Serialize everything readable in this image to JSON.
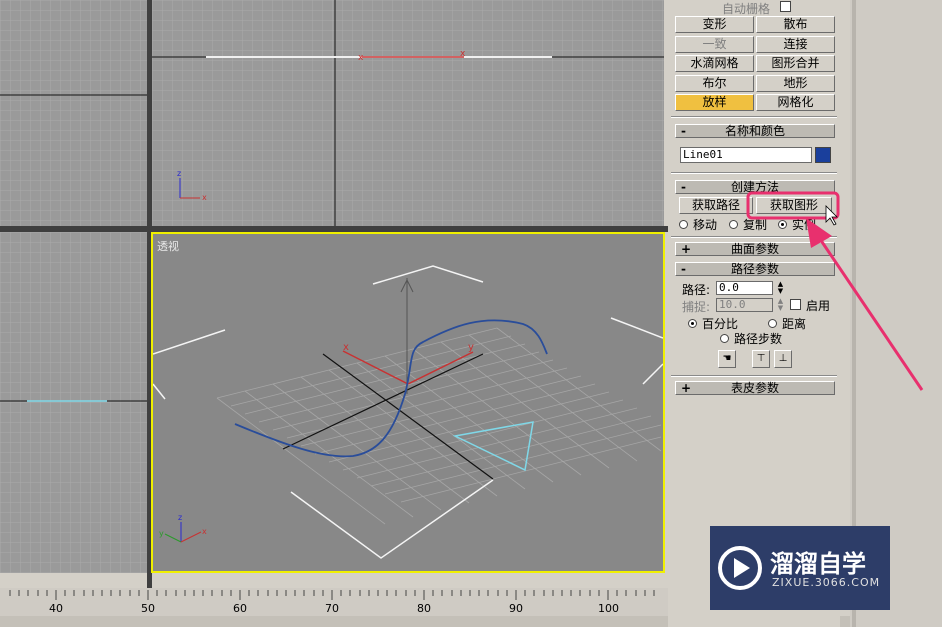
{
  "viewports": {
    "perspective_label": "透视"
  },
  "panel": {
    "auto_grid_label": "自动栅格",
    "object_buttons": [
      {
        "label": "变形",
        "state": "normal"
      },
      {
        "label": "散布",
        "state": "normal"
      },
      {
        "label": "一致",
        "state": "disabled"
      },
      {
        "label": "连接",
        "state": "normal"
      },
      {
        "label": "水滴网格",
        "state": "normal"
      },
      {
        "label": "图形合并",
        "state": "normal"
      },
      {
        "label": "布尔",
        "state": "normal"
      },
      {
        "label": "地形",
        "state": "normal"
      },
      {
        "label": "放样",
        "state": "active"
      },
      {
        "label": "网格化",
        "state": "normal"
      }
    ],
    "name_color": {
      "title": "名称和颜色",
      "object_name": "Line01",
      "color": "#1a3f9c"
    },
    "creation_method": {
      "title": "创建方法",
      "get_path": "获取路径",
      "get_shape": "获取图形",
      "move": "移动",
      "copy": "复制",
      "instance": "实例"
    },
    "surface_params": {
      "title": "曲面参数"
    },
    "path_params": {
      "title": "路径参数",
      "path_label": "路径:",
      "path_value": "0.0",
      "snap_label": "捕捉:",
      "snap_value": "10.0",
      "enable_label": "启用",
      "percent_label": "百分比",
      "distance_label": "距离",
      "path_steps_label": "路径步数"
    },
    "skin_params": {
      "title": "表皮参数"
    }
  },
  "ruler": {
    "ticks": [
      "40",
      "50",
      "60",
      "70",
      "80",
      "90",
      "100"
    ]
  },
  "watermark": {
    "title": "溜溜自学",
    "url": "ZIXUE.3066.COM"
  },
  "colors": {
    "highlight": "#e8306e",
    "viewport_active": "#f0f000",
    "button_active": "#f0c040"
  }
}
